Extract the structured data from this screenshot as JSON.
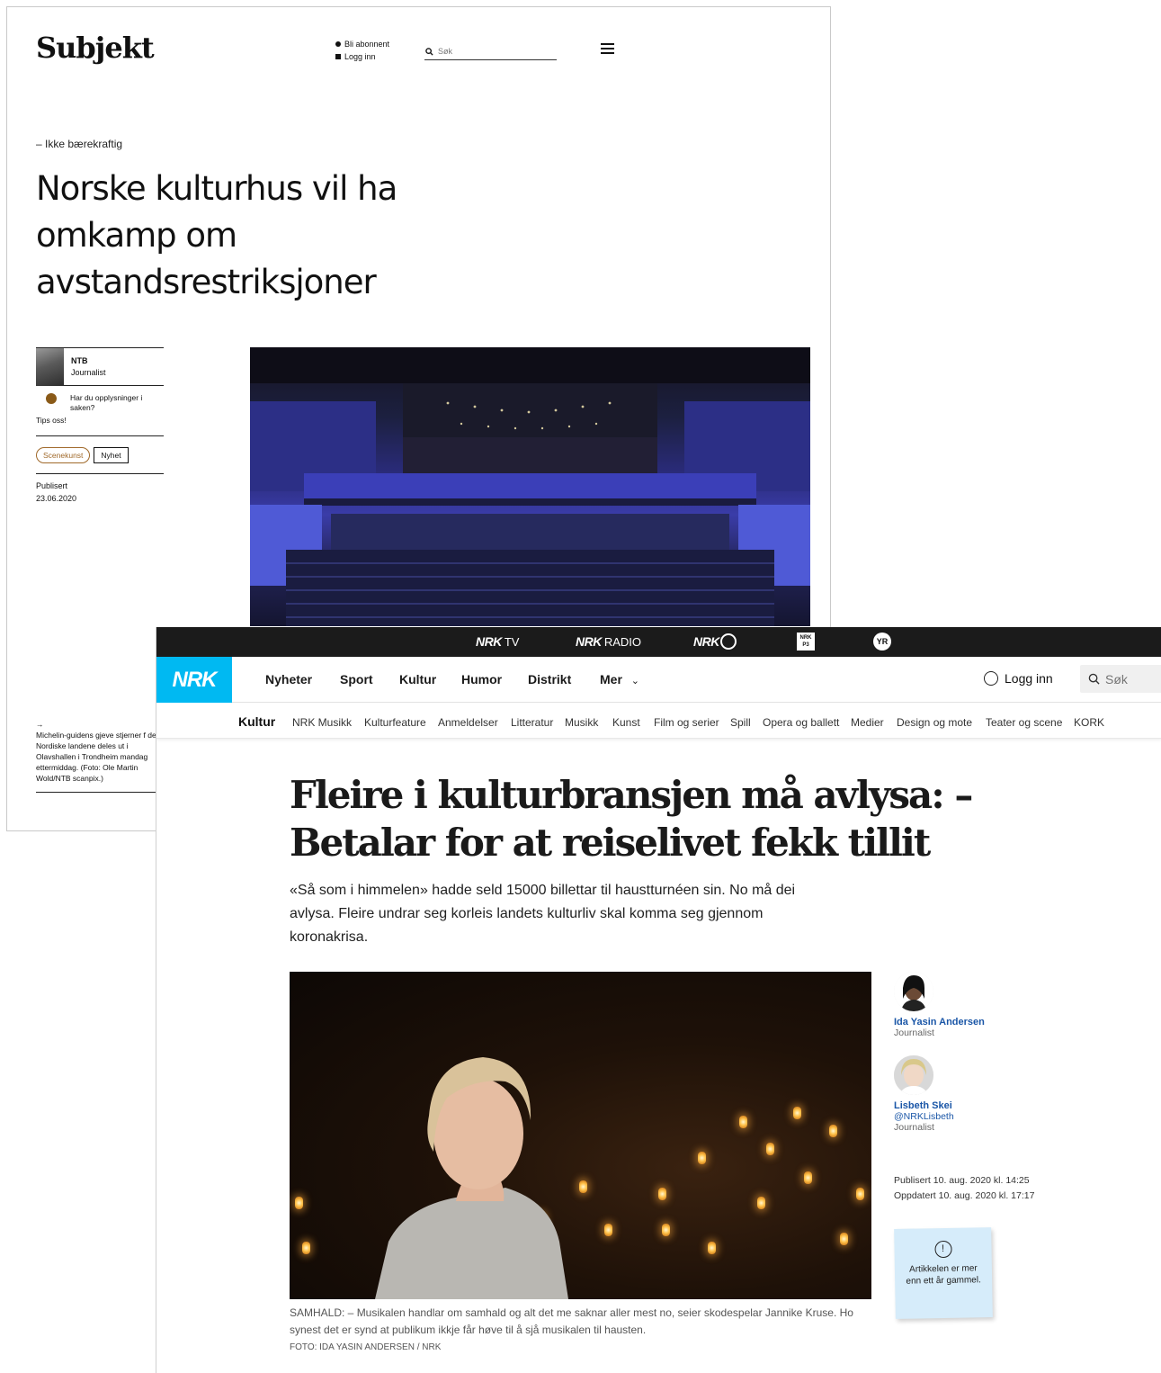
{
  "subjekt": {
    "logo": "Subjekt",
    "subscribe": "Bli abonnent",
    "login": "Logg inn",
    "search_placeholder": "Søk",
    "kicker": "– Ikke bærekraftig",
    "title": "Norske kulturhus vil ha omkamp om avstandsrestriksjoner",
    "author_name": "NTB",
    "author_role": "Journalist",
    "tips_question": "Har du opplysninger i saken?",
    "tips_link": "Tips oss!",
    "tags": [
      "Scenekunst",
      "Nyhet"
    ],
    "published_label": "Publisert",
    "published_date": "23.06.2020",
    "caption_arrow": "→",
    "caption": "Michelin-guidens gjeve stjerner f de Nordiske landene deles ut i Olavshallen i Trondheim mandag ettermiddag. (Foto: Ole Martin Wold/NTB scanpix.)",
    "colors": {
      "tip_dot": "#8a5a18",
      "tag_accent": "#a0692a"
    }
  },
  "nrk": {
    "topbar": {
      "tv_brand": "NRK",
      "tv_label": "TV",
      "radio_brand": "NRK",
      "radio_label": "RADIO",
      "super_brand": "NRK",
      "p3_label": "NRK P3",
      "yr_label": "YR"
    },
    "logo": "NRK",
    "nav": [
      "Nyheter",
      "Sport",
      "Kultur",
      "Humor",
      "Distrikt",
      "Mer"
    ],
    "login": "Logg inn",
    "search_placeholder": "Søk",
    "section": "Kultur",
    "subnav": [
      "NRK Musikk",
      "Kulturfeature",
      "Anmeldelser",
      "Litteratur",
      "Musikk",
      "Kunst",
      "Film og serier",
      "Spill",
      "Opera og ballett",
      "Medier",
      "Design og mote",
      "Teater og scene",
      "KORK"
    ],
    "headline": "Fleire i kulturbransjen må avlysa: – Betalar for at reiselivet fekk tillit",
    "lead": "«Så som i himmelen» hadde seld 15000 billettar til haustturnéen sin. No må dei avlysa. Fleire undrar seg korleis landets kulturliv skal komma seg gjennom koronakrisa.",
    "caption": "SAMHALD: – Musikalen handlar om samhald og alt det me saknar aller mest no, seier skodespelar Jannike Kruse. Ho synest det er synd at publikum ikkje får høve til å sjå musikalen til hausten.",
    "photo_credit": "FOTO: IDA YASIN ANDERSEN / NRK",
    "authors": [
      {
        "name": "Ida Yasin Andersen",
        "handle": "",
        "role": "Journalist"
      },
      {
        "name": "Lisbeth Skei",
        "handle": "@NRKLisbeth",
        "role": "Journalist"
      }
    ],
    "published": "Publisert 10. aug. 2020 kl. 14:25",
    "updated": "Oppdatert 10. aug. 2020 kl. 17:17",
    "note_icon": "exclamation-circle-icon",
    "note_text": "Artikkelen er mer enn ett år gammel.",
    "colors": {
      "brand": "#00b9f2",
      "topbar": "#1b1b1b",
      "author_link": "#1a56a7",
      "note": "#d6ecfa"
    }
  }
}
